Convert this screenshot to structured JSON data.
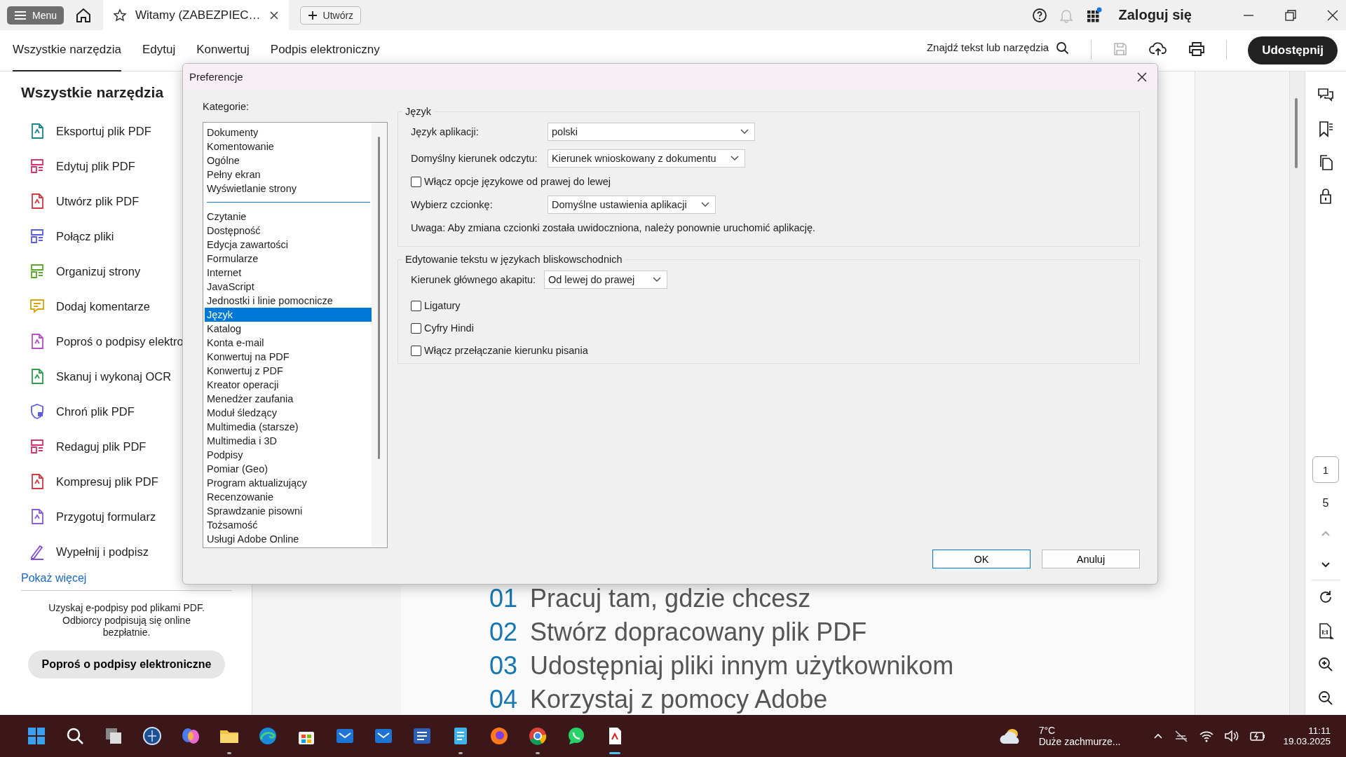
{
  "top_bar": {
    "menu_button": "Menu",
    "tab": {
      "title": "Witamy (ZABEZPIEC…",
      "selected": true
    },
    "create_button": "Utwórz",
    "apps_badge": true,
    "sign_in": "Zaloguj się"
  },
  "toolbar": {
    "tabs": [
      {
        "label": "Wszystkie narzędzia",
        "selected": true
      },
      {
        "label": "Edytuj",
        "selected": false
      },
      {
        "label": "Konwertuj",
        "selected": false
      },
      {
        "label": "Podpis elektroniczny",
        "selected": false
      }
    ],
    "search": "Znajdź tekst lub narzędzia",
    "save_disabled": true,
    "share_button": "Udostępnij"
  },
  "tools_panel": {
    "title": "Wszystkie narzędzia",
    "items": [
      {
        "label": "Eksportuj plik PDF",
        "kind": "page",
        "color": "#16878c"
      },
      {
        "label": "Edytuj plik PDF",
        "kind": "layout",
        "color": "#d6336c"
      },
      {
        "label": "Utwórz plik PDF",
        "kind": "page",
        "color": "#d7373f"
      },
      {
        "label": "Połącz pliki",
        "kind": "layout",
        "color": "#5c5ce0"
      },
      {
        "label": "Organizuj strony",
        "kind": "layout",
        "color": "#5aa62a"
      },
      {
        "label": "Dodaj komentarze",
        "kind": "comment",
        "color": "#d9a400"
      },
      {
        "label": "Poproś o podpisy elektro",
        "kind": "page",
        "color": "#b54fc4"
      },
      {
        "label": "Skanuj i wykonaj OCR",
        "kind": "page",
        "color": "#2d9d4b"
      },
      {
        "label": "Chroń plik PDF",
        "kind": "shield",
        "color": "#5c5ce0"
      },
      {
        "label": "Redaguj plik PDF",
        "kind": "layout",
        "color": "#d6336c"
      },
      {
        "label": "Kompresuj plik PDF",
        "kind": "page",
        "color": "#d7373f"
      },
      {
        "label": "Przygotuj formularz",
        "kind": "page",
        "color": "#8a5bd6"
      },
      {
        "label": "Wypełnij i podpisz",
        "kind": "pen",
        "color": "#7d4fd6"
      }
    ],
    "more_link": "Pokaż więcej",
    "promo": "Uzyskaj e-podpisy pod plikami PDF. Odbiorcy podpisują się online bezpłatnie.",
    "promo_button": "Poproś o podpisy elektroniczne"
  },
  "document": {
    "headings": [
      {
        "number": "01",
        "text": "Pracuj tam, gdzie chcesz"
      },
      {
        "number": "02",
        "text": "Stwórz dopracowany plik PDF"
      },
      {
        "number": "03",
        "text": "Udostępniaj pliki innym użytkownikom"
      },
      {
        "number": "04",
        "text": "Korzystaj z pomocy Adobe"
      }
    ]
  },
  "right_rail": {
    "page_current": "1",
    "page_total": "5",
    "prev_disabled": true
  },
  "dialog": {
    "title": "Preferencje",
    "categories_label": "Kategorie:",
    "category_groups": [
      [
        {
          "label": "Dokumenty",
          "selected": false
        },
        {
          "label": "Komentowanie",
          "selected": false
        },
        {
          "label": "Ogólne",
          "selected": false
        },
        {
          "label": "Pełny ekran",
          "selected": false
        },
        {
          "label": "Wyświetlanie strony",
          "selected": false
        }
      ],
      [
        {
          "label": "Czytanie",
          "selected": false
        },
        {
          "label": "Dostępność",
          "selected": false
        },
        {
          "label": "Edycja zawartości",
          "selected": false
        },
        {
          "label": "Formularze",
          "selected": false
        },
        {
          "label": "Internet",
          "selected": false
        },
        {
          "label": "JavaScript",
          "selected": false
        },
        {
          "label": "Jednostki i linie pomocnicze",
          "selected": false
        },
        {
          "label": "Język",
          "selected": true
        },
        {
          "label": "Katalog",
          "selected": false
        },
        {
          "label": "Konta e-mail",
          "selected": false
        },
        {
          "label": "Konwertuj na PDF",
          "selected": false
        },
        {
          "label": "Konwertuj z PDF",
          "selected": false
        },
        {
          "label": "Kreator operacji",
          "selected": false
        },
        {
          "label": "Menedżer zaufania",
          "selected": false
        },
        {
          "label": "Moduł śledzący",
          "selected": false
        },
        {
          "label": "Multimedia (starsze)",
          "selected": false
        },
        {
          "label": "Multimedia i 3D",
          "selected": false
        },
        {
          "label": "Podpisy",
          "selected": false
        },
        {
          "label": "Pomiar (Geo)",
          "selected": false
        },
        {
          "label": "Program aktualizujący",
          "selected": false
        },
        {
          "label": "Recenzowanie",
          "selected": false
        },
        {
          "label": "Sprawdzanie pisowni",
          "selected": false
        },
        {
          "label": "Tożsamość",
          "selected": false
        },
        {
          "label": "Usługi Adobe Online",
          "selected": false
        }
      ]
    ],
    "language_group": {
      "title": "Język",
      "selects": [
        {
          "label": "Język aplikacji:",
          "value": "polski"
        },
        {
          "label": "Domyślny kierunek odczytu:",
          "value": "Kierunek wnioskowany z dokumentu"
        }
      ],
      "rtl_option": {
        "label": "Włącz opcje językowe od prawej do lewej",
        "checked": false
      },
      "font": {
        "label": "Wybierz czcionkę:",
        "value": "Domyślne ustawienia aplikacji"
      },
      "note": "Uwaga: Aby zmiana czcionki została uwidoczniona, należy ponownie uruchomić aplikację."
    },
    "middle_east_group": {
      "title": "Edytowanie tekstu w językach bliskowschodnich",
      "paragraph_direction": {
        "label": "Kierunek głównego akapitu:",
        "value": "Od lewej do prawej"
      },
      "options": [
        {
          "label": "Ligatury",
          "checked": false
        },
        {
          "label": "Cyfry Hindi",
          "checked": false
        },
        {
          "label": "Włącz przełączanie kierunku pisania",
          "checked": false
        }
      ]
    },
    "ok_button": "OK",
    "cancel_button": "Anuluj"
  },
  "taskbar": {
    "apps": [
      {
        "kind": "start",
        "running": false
      },
      {
        "kind": "search",
        "running": false
      },
      {
        "kind": "taskview",
        "running": false
      },
      {
        "kind": "globe",
        "running": false
      },
      {
        "kind": "swirl",
        "running": false
      },
      {
        "kind": "folder",
        "running": true
      },
      {
        "kind": "browser",
        "running": false
      },
      {
        "kind": "bag",
        "running": false
      },
      {
        "kind": "mail",
        "running": false
      },
      {
        "kind": "mail",
        "running": false
      },
      {
        "kind": "doc",
        "running": false
      },
      {
        "kind": "notepad",
        "running": true
      },
      {
        "kind": "fox",
        "running": false
      },
      {
        "kind": "wheel",
        "running": true
      },
      {
        "kind": "chat",
        "running": false
      },
      {
        "kind": "pdf",
        "running": true
      }
    ],
    "temperature": "7°C",
    "weather": "Duże zachmurze...",
    "time": "11:11",
    "date": "19.03.2025"
  }
}
